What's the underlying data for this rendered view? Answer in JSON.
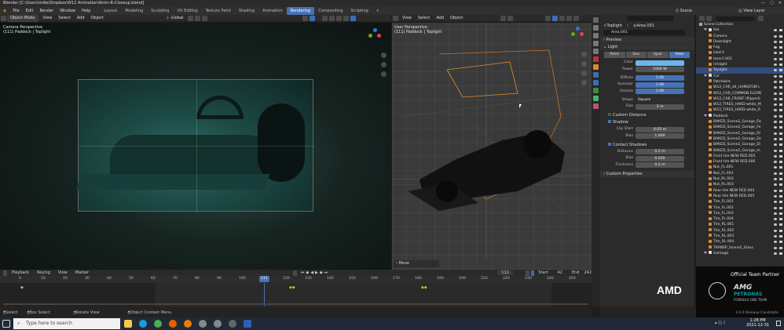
{
  "titlebar": {
    "title": "Blender [C:\\Users\\mike\\Dropbox\\W12 Animation\\Anim-B-Closeup.blend]"
  },
  "menubar": {
    "menus": [
      "File",
      "Edit",
      "Render",
      "Window",
      "Help"
    ],
    "workspaces": [
      "Layout",
      "Modeling",
      "Sculpting",
      "UV Editing",
      "Texture Paint",
      "Shading",
      "Animation",
      "Rendering",
      "Compositing",
      "Scripting"
    ],
    "active_workspace": "Rendering",
    "plus": "+",
    "scene": "Scene",
    "view_layer": "View Layer"
  },
  "camera_view": {
    "mode": "Object Mode",
    "menus": [
      "View",
      "Select",
      "Add",
      "Object"
    ],
    "orientation": "Global",
    "label": "Camera Perspective",
    "sublabel": "(111) Paddock | Toplight"
  },
  "user_view": {
    "menus": [
      "View",
      "Select",
      "Add",
      "Object"
    ],
    "label": "User Perspective",
    "sublabel": "(111) Paddock | Toplight",
    "operator": "Move"
  },
  "properties": {
    "object_name": "Toplight",
    "data_name": "Area.001",
    "datablock": "Area.001",
    "sections": {
      "preview": "Preview",
      "light": "Light",
      "shadow": "Shadow",
      "contact_shadows": "Contact Shadows",
      "custom_distance": "Custom Distance",
      "custom_properties": "Custom Properties"
    },
    "light_types": [
      "Point",
      "Sun",
      "Spot",
      "Area"
    ],
    "active_light_type": "Area",
    "fields": [
      {
        "label": "Color",
        "value": ""
      },
      {
        "label": "Power",
        "value": "1000 W"
      },
      {
        "label": "Diffuse",
        "value": "1.00"
      },
      {
        "label": "Specular",
        "value": "1.00"
      },
      {
        "label": "Volume",
        "value": "1.00"
      },
      {
        "label": "Shape",
        "value": "Square"
      },
      {
        "label": "Size",
        "value": "3 m"
      }
    ],
    "shadow_fields": [
      {
        "label": "Clip Start",
        "value": "0.05 m"
      },
      {
        "label": "Bias",
        "value": "1.000"
      }
    ],
    "contact_fields": [
      {
        "label": "Distance",
        "value": "0.2 m"
      },
      {
        "label": "Bias",
        "value": "0.030"
      },
      {
        "label": "Thickness",
        "value": "0.2 m"
      }
    ],
    "colors": {
      "light_color": "#6ab6ee",
      "accent": "#4772b3"
    }
  },
  "outliner": {
    "root": "Scene Collection",
    "items": [
      {
        "name": "Set",
        "level": 1,
        "group": true
      },
      {
        "name": "Camera",
        "level": 2
      },
      {
        "name": "Downlight",
        "level": 2
      },
      {
        "name": "Fog",
        "level": 2
      },
      {
        "name": "laser2",
        "level": 2
      },
      {
        "name": "laser2.001",
        "level": 2
      },
      {
        "name": "rimlight",
        "level": 2
      },
      {
        "name": "Toplight",
        "level": 2,
        "selected": true
      },
      {
        "name": "Car",
        "level": 1,
        "group": true
      },
      {
        "name": "Patchwire",
        "level": 2
      },
      {
        "name": "W12_CAR_44_HAMILTON's",
        "level": 2
      },
      {
        "name": "W12_CAR_COMMON ELEME",
        "level": 2
      },
      {
        "name": "W12_CAR_FRONT (flipped)",
        "level": 2
      },
      {
        "name": "W12_TIRES_HARD-white_M",
        "level": 2
      },
      {
        "name": "W12_TIRES_HARD-white_R",
        "level": 2
      },
      {
        "name": "Paddock",
        "level": 1,
        "group": true
      },
      {
        "name": "BAKED_Scene2_Garage_Dc",
        "level": 2
      },
      {
        "name": "BAKED_Scene2_Garage_Fe",
        "level": 2
      },
      {
        "name": "BAKED_Scene2_Garage_Di",
        "level": 2
      },
      {
        "name": "BAKED_Scene2_Garage_Dc",
        "level": 2
      },
      {
        "name": "BAKED_Scene2_Garage_Di",
        "level": 2
      },
      {
        "name": "BAKED_Scene2_Garage_m",
        "level": 2
      },
      {
        "name": "Front tire NEW RED.005",
        "level": 2
      },
      {
        "name": "Front tire NEW RED.006",
        "level": 2
      },
      {
        "name": "Nut_FL.001",
        "level": 2
      },
      {
        "name": "Nut_FL.003",
        "level": 2
      },
      {
        "name": "Nut_RL.002",
        "level": 2
      },
      {
        "name": "Nut_RL.003",
        "level": 2
      },
      {
        "name": "Rear tire NEW RED.004",
        "level": 2
      },
      {
        "name": "Rear tire NEW RED.005",
        "level": 2
      },
      {
        "name": "Tire_FL.001",
        "level": 2
      },
      {
        "name": "Tire_FL.002",
        "level": 2
      },
      {
        "name": "Tire_FL.003",
        "level": 2
      },
      {
        "name": "Tire_FL.004",
        "level": 2
      },
      {
        "name": "Tire_RL.001",
        "level": 2
      },
      {
        "name": "Tire_RL.002",
        "level": 2
      },
      {
        "name": "Tire_RL.003",
        "level": 2
      },
      {
        "name": "Tire_RL.004",
        "level": 2
      },
      {
        "name": "TRANSP_Scene2_Glass",
        "level": 2
      },
      {
        "name": "Garbage",
        "level": 1,
        "group": true
      }
    ]
  },
  "sponsor": {
    "line1": "Official Team Partner",
    "amd": "AMD",
    "amg": "AMG",
    "petronas": "PETRONAS",
    "formula": "FORMULA ONE TEAM",
    "version": "3.0.0 Release Candidate"
  },
  "timeline": {
    "menus": [
      "Playback",
      "Keying",
      "View",
      "Marker"
    ],
    "current_frame": "111",
    "start_label": "Start",
    "start": "42",
    "end_label": "End",
    "end": "242",
    "ticks": [
      "0",
      "10",
      "20",
      "30",
      "40",
      "50",
      "60",
      "70",
      "80",
      "90",
      "100",
      "110",
      "120",
      "130",
      "140",
      "150",
      "160",
      "170",
      "180",
      "190",
      "200",
      "210",
      "220",
      "230",
      "240",
      "250"
    ]
  },
  "status": {
    "select": "Select",
    "box_select": "Box Select",
    "rotate_view": "Rotate View",
    "context_menu": "Object Context Menu"
  },
  "taskbar": {
    "search_placeholder": "Type here to search",
    "time": "1:28 PM",
    "date": "2021-12-31"
  }
}
